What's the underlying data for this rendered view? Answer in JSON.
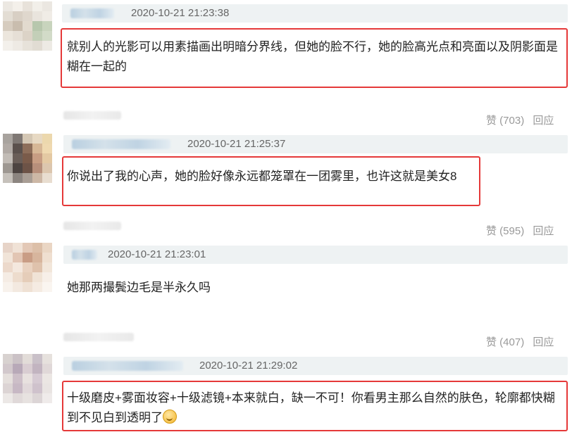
{
  "comments": [
    {
      "timestamp": "2020-10-21 21:23:38",
      "text": "就别人的光影可以用素描画出明暗分界线，但她的脸不行，她的脸高光点和亮面以及阴影面是糊在一起的",
      "likes_label": "赞 (703)",
      "reply_label": "回应",
      "avatar_colors": [
        "#ece8e2",
        "#f4f0ea",
        "#e8e2da",
        "#f2efe9",
        "#ebe7e1",
        "#e3ddd4",
        "#d8cfc4",
        "#dfd7cd",
        "#e9e4dd",
        "#f0ece6",
        "#d6ccbf",
        "#c9bdae",
        "#e2dace",
        "#b7c7ad",
        "#c8d4bd",
        "#ece6dd",
        "#e6dfd6",
        "#dcd3c7",
        "#c3cfb8",
        "#d2dbc8",
        "#f3f0eb",
        "#eeeae4",
        "#e7e2da",
        "#e1dcd3",
        "#edeae4"
      ]
    },
    {
      "timestamp": "2020-10-21 21:25:37",
      "text": "你说出了我的心声，她的脸好像永远都笼罩在一团雾里，也许这就是美女8",
      "likes_label": "赞 (595)",
      "reply_label": "回应",
      "avatar_colors": [
        "#a8a39e",
        "#7f7874",
        "#d4c7b4",
        "#e7d9c3",
        "#ecd8ad",
        "#b1aaa5",
        "#5b514d",
        "#8d6e5a",
        "#d6b796",
        "#efd9b0",
        "#c2bcb6",
        "#6a5e58",
        "#7a5b4a",
        "#c79d83",
        "#e4c9a3",
        "#9e9892",
        "#4d4441",
        "#6d5347",
        "#b78f7b",
        "#dcc6ae",
        "#c6c1bb",
        "#8c8580",
        "#a99e95",
        "#cdb8a6",
        "#e8ddd0"
      ]
    },
    {
      "timestamp": "2020-10-21 21:23:01",
      "text": "她那两撮鬓边毛是半永久吗",
      "likes_label": "赞 (407)",
      "reply_label": "回应",
      "avatar_colors": [
        "#e7d4c8",
        "#f0e2d6",
        "#e3c8b6",
        "#dcbfa8",
        "#ead6c4",
        "#f1e4d8",
        "#e2c5b3",
        "#c99d85",
        "#d7b59d",
        "#efdfd0",
        "#ecd9cb",
        "#f4e8de",
        "#e9d2c0",
        "#dfc2ac",
        "#f2e6da",
        "#f5ece4",
        "#eddccd",
        "#e5cdb9",
        "#f0e3d6",
        "#f7efe8",
        "#f8f2ec",
        "#f3e9e0",
        "#efe1d4",
        "#f5ebe2",
        "#faf5f0"
      ]
    },
    {
      "timestamp": "2020-10-21 21:29:02",
      "text": "十级磨皮+雾面妆容+十级滤镜+本来就白，缺一不可！你看男主那么自然的肤色，轮廓都快糊到不见白到透明了",
      "avatar_colors": [
        "#d8d2d0",
        "#cbc2c6",
        "#e2dcd8",
        "#c9c0c8",
        "#e6e1dd",
        "#d2c8cc",
        "#b8a9b8",
        "#d9cdd2",
        "#c2b4c0",
        "#e0d8d8",
        "#e5dfdc",
        "#cdbfc8",
        "#e8e1df",
        "#d6cad3",
        "#ebe6e3",
        "#dcd4d4",
        "#c7b8c4",
        "#e1d8da",
        "#cfc2cc",
        "#e9e4e2",
        "#ece8e6",
        "#e0d9d9",
        "#e7e2e0",
        "#dcd5d6",
        "#efebea"
      ]
    }
  ]
}
